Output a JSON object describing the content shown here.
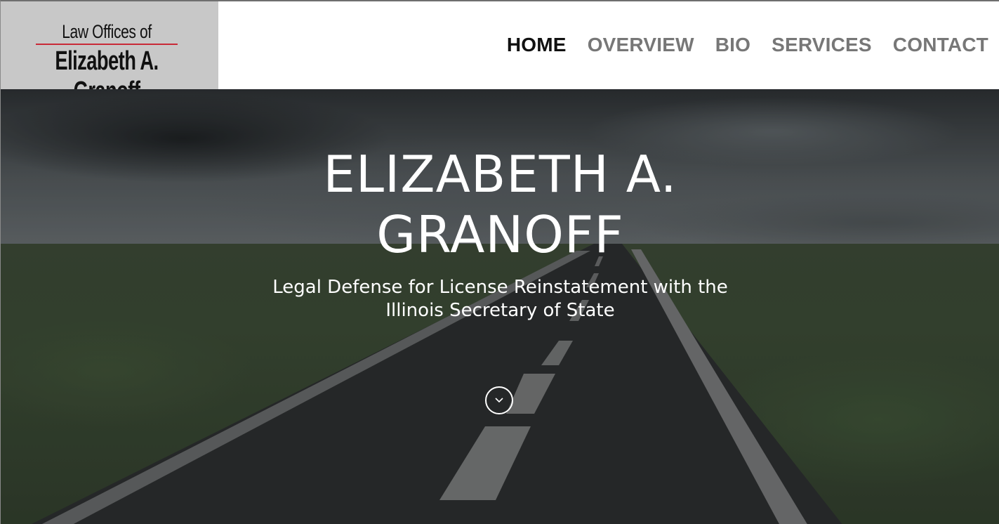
{
  "logo": {
    "line1": "Law Offices of",
    "line2": "Elizabeth A. Granoff"
  },
  "nav": {
    "items": [
      {
        "label": "HOME",
        "active": true
      },
      {
        "label": "OVERVIEW",
        "active": false
      },
      {
        "label": "BIO",
        "active": false
      },
      {
        "label": "SERVICES",
        "active": false
      },
      {
        "label": "CONTACT",
        "active": false
      }
    ]
  },
  "hero": {
    "title_line1": "ELIZABETH A.",
    "title_line2": "GRANOFF",
    "subtitle_line1": "Legal Defense for License Reinstatement with the",
    "subtitle_line2": "Illinois Secretary of State",
    "scroll_icon": "chevron-down-icon"
  },
  "colors": {
    "nav_active": "#111111",
    "nav_inactive": "#777777",
    "logo_background": "#c8c8c8",
    "logo_rule": "#c92a37",
    "hero_text": "#ffffff"
  }
}
